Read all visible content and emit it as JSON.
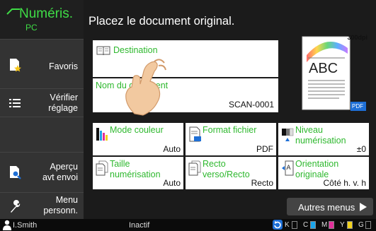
{
  "mode": {
    "title": "Numéris.",
    "subtitle": "PC",
    "color": "#3fdc46"
  },
  "sidebar": {
    "items": [
      {
        "icon": "favorites-star-document-icon",
        "label_lines": [
          "Favoris"
        ]
      },
      {
        "icon": "list-icon",
        "label_lines": [
          "Vérifier",
          "réglage"
        ]
      },
      {
        "icon": "magnifier-document-icon",
        "label_lines": [
          "Aperçu",
          "avt envoi"
        ]
      },
      {
        "icon": "wrench-icon",
        "label_lines": [
          "Menu",
          "personn."
        ]
      }
    ]
  },
  "message": "Placez le document original.",
  "preview": {
    "dpi": "300dpi",
    "sample_text": "ABC",
    "format_tag": "PDF"
  },
  "destination": {
    "label": "Destination"
  },
  "file_name": {
    "label": "Nom du document",
    "value": "SCAN-0001"
  },
  "settings": [
    {
      "icon": "color-mode-icon",
      "label_lines": [
        "Mode couleur"
      ],
      "value": "Auto"
    },
    {
      "icon": "file-format-icon",
      "label_lines": [
        "Format fichier"
      ],
      "value": "PDF"
    },
    {
      "icon": "scan-level-icon",
      "label_lines": [
        "Niveau",
        "numérisation"
      ],
      "value": "±0"
    },
    {
      "icon": "scan-size-icon",
      "label_lines": [
        "Taille",
        "numérisation"
      ],
      "value": "Auto"
    },
    {
      "icon": "duplex-icon",
      "label_lines": [
        "Recto",
        "verso/Recto"
      ],
      "value": "Recto"
    },
    {
      "icon": "orientation-icon",
      "label_lines": [
        "Orientation",
        "originale"
      ],
      "value": "Côté h. v. h"
    }
  ],
  "more_menus": "Autres menus",
  "status": {
    "user": "I.Smith",
    "state": "Inactif",
    "inks": [
      {
        "label": "K",
        "color": "#000000",
        "level": 0.0
      },
      {
        "label": "C",
        "color": "#1aa3e8",
        "level": 1.0
      },
      {
        "label": "M",
        "color": "#e0309a",
        "level": 1.0
      },
      {
        "label": "Y",
        "color": "#f2d21c",
        "level": 1.0
      },
      {
        "label": "G",
        "color": "#888888",
        "level": 0.0
      }
    ]
  }
}
